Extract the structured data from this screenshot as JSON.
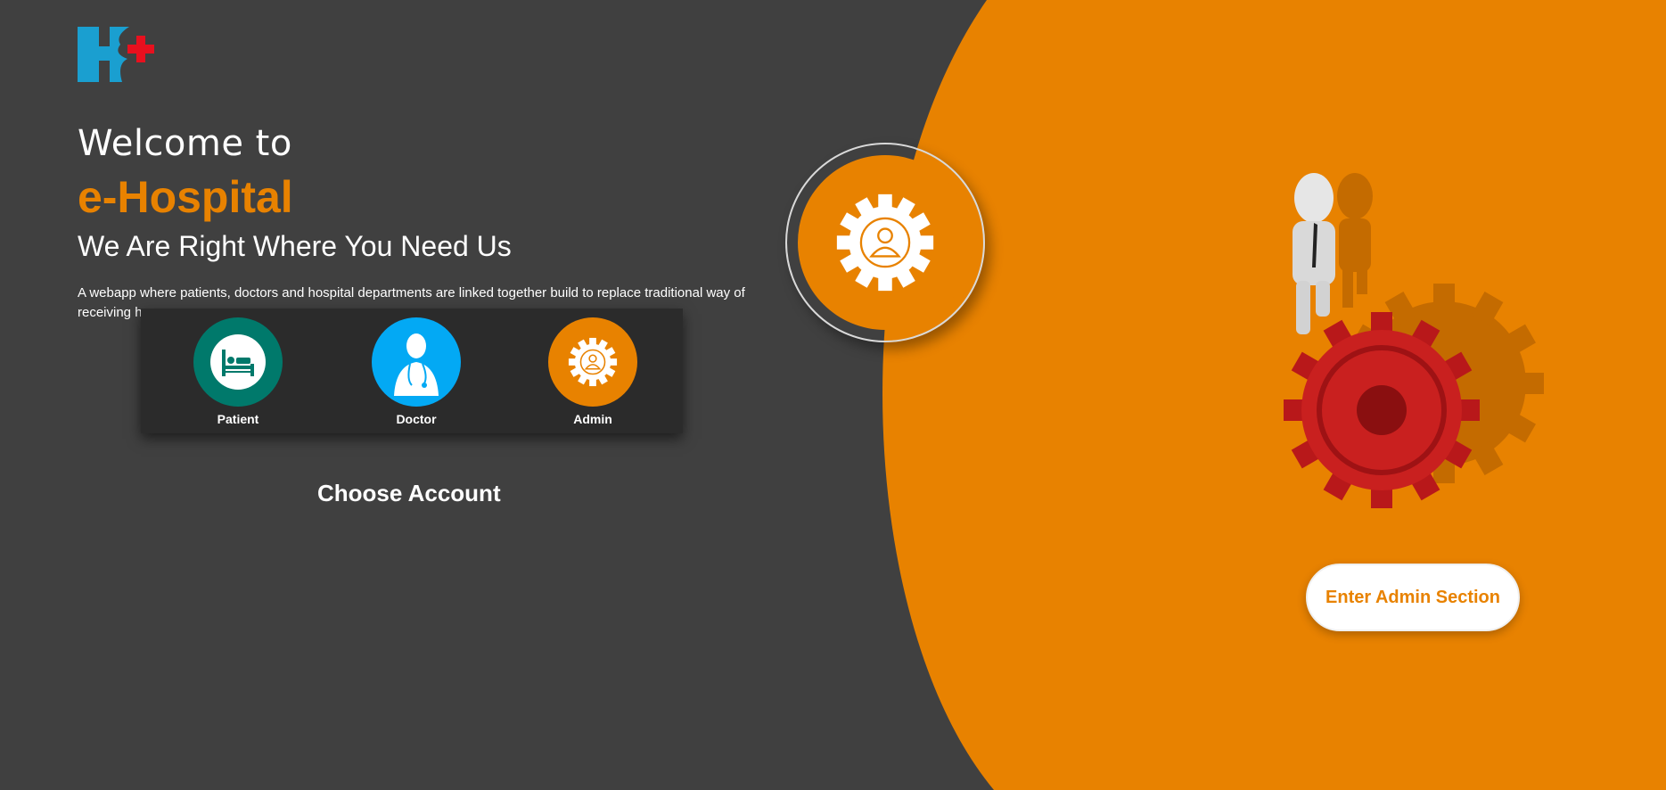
{
  "hero": {
    "welcome": "Welcome to",
    "brand": "e-Hospital",
    "tagline": "We Are Right Where You Need Us",
    "description": "A webapp where patients, doctors and hospital departments are linked together build to replace traditional way of receiving h"
  },
  "accounts": [
    {
      "label": "Patient",
      "icon": "hospital-bed-icon",
      "color": "#00796b"
    },
    {
      "label": "Doctor",
      "icon": "doctor-icon",
      "color": "#03a9f4"
    },
    {
      "label": "Admin",
      "icon": "gear-user-icon",
      "color": "#e88200"
    }
  ],
  "choose_label": "Choose Account",
  "selected_account": "Admin",
  "admin_section": {
    "button_label": "Enter Admin Section"
  },
  "colors": {
    "background": "#404040",
    "accent": "#e88200",
    "panel": "#2b2b2b",
    "logo_blue": "#1a9fd0",
    "logo_red": "#e8101e"
  }
}
